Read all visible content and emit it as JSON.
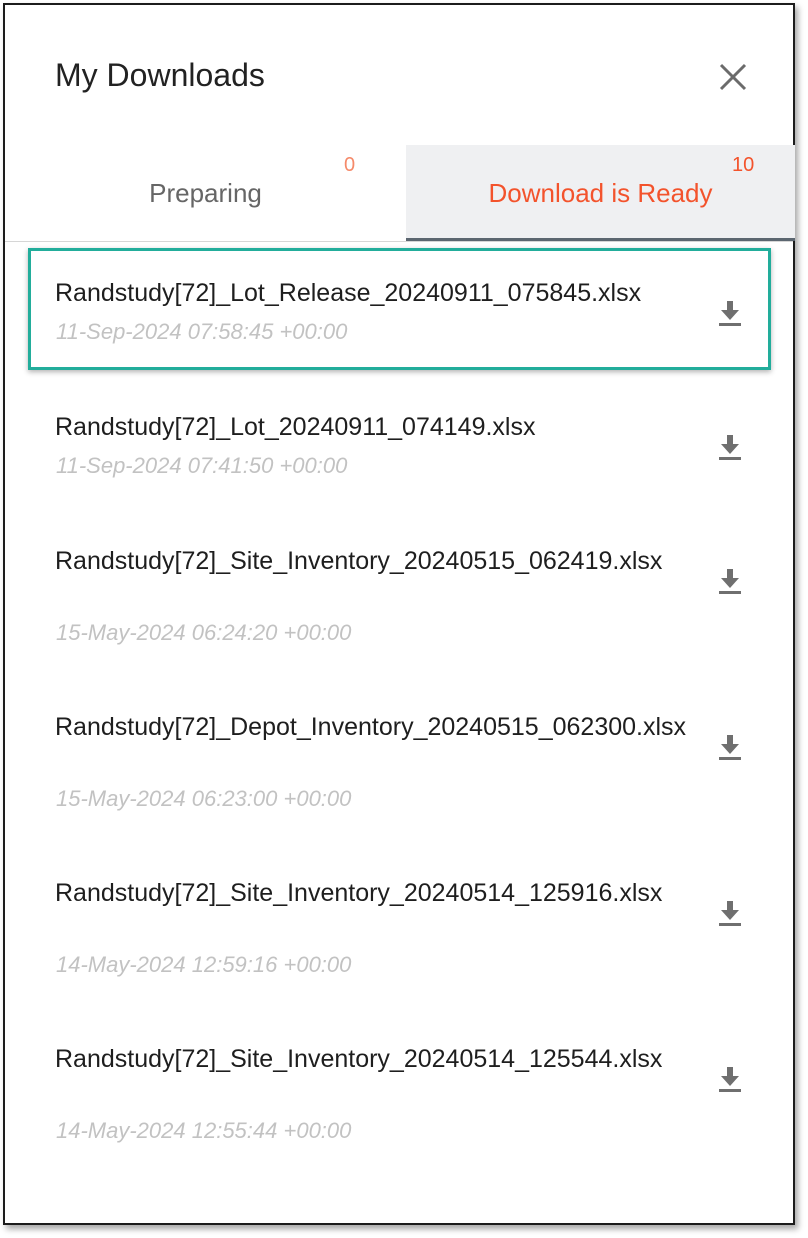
{
  "panel": {
    "title": "My Downloads",
    "close_icon": "close-icon"
  },
  "tabs": [
    {
      "label": "Preparing",
      "count": "0"
    },
    {
      "label": "Download is Ready",
      "count": "10"
    }
  ],
  "active_tab": "Download is Ready",
  "downloads": [
    {
      "name": "Randstudy[72]_Lot_Release_20240911_075845.xlsx",
      "time": "11-Sep-2024 07:58:45 +00:00",
      "icon": "download-icon"
    },
    {
      "name": "Randstudy[72]_Lot_20240911_074149.xlsx",
      "time": "11-Sep-2024 07:41:50 +00:00",
      "icon": "download-icon"
    },
    {
      "name": "Randstudy[72]_Site_Inventory_20240515_062419.xlsx",
      "time": "15-May-2024 06:24:20 +00:00",
      "icon": "download-icon"
    },
    {
      "name": "Randstudy[72]_Depot_Inventory_20240515_062300.xlsx",
      "time": "15-May-2024 06:23:00 +00:00",
      "icon": "download-icon"
    },
    {
      "name": "Randstudy[72]_Site_Inventory_20240514_125916.xlsx",
      "time": "14-May-2024 12:59:16 +00:00",
      "icon": "download-icon"
    },
    {
      "name": "Randstudy[72]_Site_Inventory_20240514_125544.xlsx",
      "time": "14-May-2024 12:55:44 +00:00",
      "icon": "download-icon"
    }
  ],
  "colors": {
    "accent": "#f3532c",
    "selection_border": "#22ad9b",
    "timestamp": "#c2c2c2",
    "active_tab_bg": "#eff0f2"
  }
}
